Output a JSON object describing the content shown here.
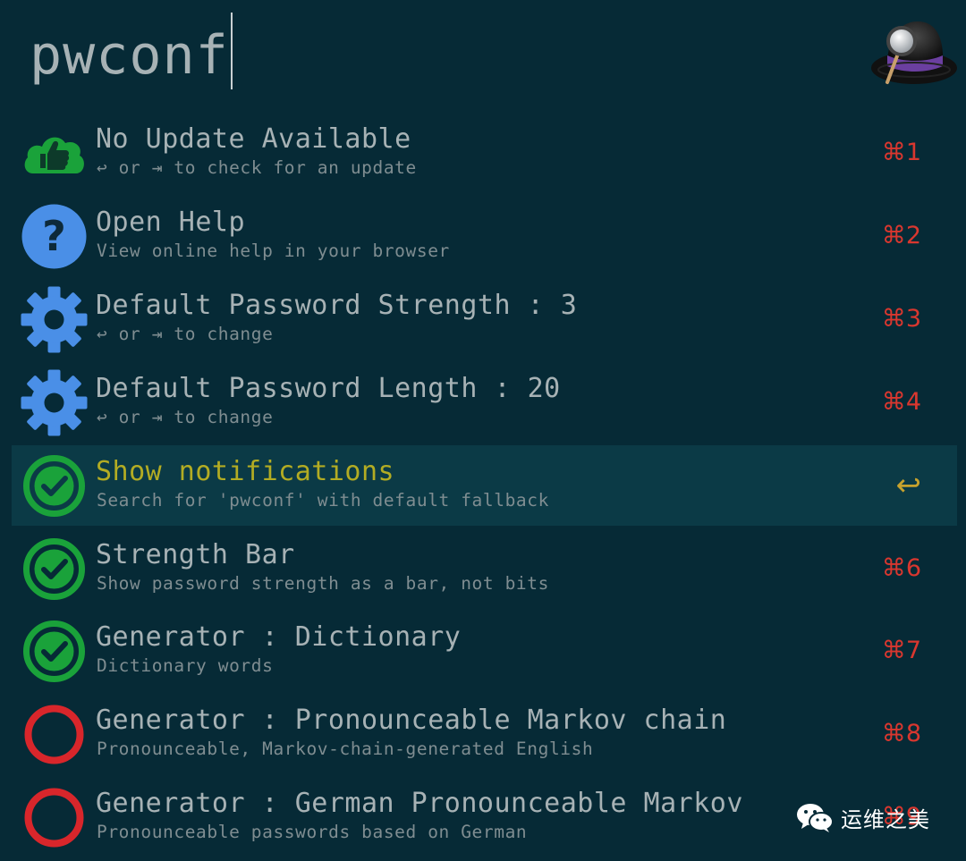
{
  "search": {
    "query": "pwconf"
  },
  "results": [
    {
      "title": "No Update Available",
      "subtitle": "↩ or ⇥ to check for an update",
      "shortcut": "⌘1",
      "icon": "thumbs-up-cloud-icon",
      "selected": false
    },
    {
      "title": "Open Help",
      "subtitle": "View online help in your browser",
      "shortcut": "⌘2",
      "icon": "help-icon",
      "selected": false
    },
    {
      "title": "Default Password Strength : 3",
      "subtitle": "↩ or ⇥ to change",
      "shortcut": "⌘3",
      "icon": "gear-icon",
      "selected": false
    },
    {
      "title": "Default Password Length : 20",
      "subtitle": "↩ or ⇥ to change",
      "shortcut": "⌘4",
      "icon": "gear-icon",
      "selected": false
    },
    {
      "title": "Show notifications",
      "subtitle": "Search for 'pwconf' with default fallback",
      "shortcut": "↩",
      "icon": "checkmark-circle-icon",
      "selected": true
    },
    {
      "title": "Strength Bar",
      "subtitle": "Show password strength as a bar, not bits",
      "shortcut": "⌘6",
      "icon": "checkmark-circle-icon",
      "selected": false
    },
    {
      "title": "Generator : Dictionary",
      "subtitle": "Dictionary words",
      "shortcut": "⌘7",
      "icon": "checkmark-circle-icon",
      "selected": false
    },
    {
      "title": "Generator : Pronounceable Markov chain",
      "subtitle": "Pronounceable, Markov-chain-generated English",
      "shortcut": "⌘8",
      "icon": "empty-circle-icon",
      "selected": false
    },
    {
      "title": "Generator : German Pronounceable Markov",
      "subtitle": "Pronounceable passwords based on German",
      "shortcut": "⌘9",
      "icon": "empty-circle-icon",
      "selected": false
    }
  ],
  "watermark": {
    "text": "运维之美",
    "icon": "wechat-icon"
  },
  "colors": {
    "background": "#062a36",
    "selected_row": "#0b3a46",
    "selected_title": "#b3ac23",
    "shortcut": "#d9372f",
    "check_green": "#1aa23a",
    "off_red": "#d8262b",
    "icon_blue": "#4a8fe7"
  }
}
